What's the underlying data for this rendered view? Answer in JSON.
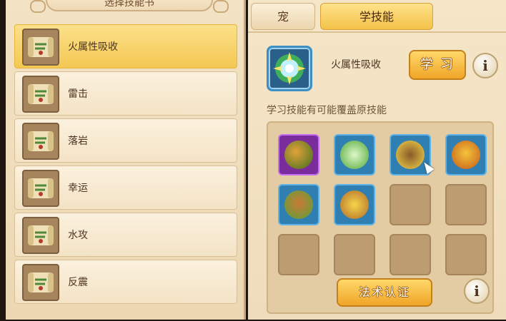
{
  "left_panel": {
    "title": "选择技能书",
    "skills": [
      {
        "name": "火属性吸收",
        "selected": true
      },
      {
        "name": "雷击",
        "selected": false
      },
      {
        "name": "落岩",
        "selected": false
      },
      {
        "name": "幸运",
        "selected": false
      },
      {
        "name": "水攻",
        "selected": false
      },
      {
        "name": "反震",
        "selected": false
      }
    ]
  },
  "tabs": [
    {
      "label": "宠",
      "active": false
    },
    {
      "label": "学技能",
      "active": true
    }
  ],
  "selected_skill": {
    "name": "火属性吸收",
    "icon": "fire-absorb-skill-icon"
  },
  "learn_button": "学习",
  "info_icon": "i",
  "hint_text": "学习技能有可能覆盖原技能",
  "pet_skills": [
    {
      "icon": "earth-skill-icon",
      "frame": "purple"
    },
    {
      "icon": "blade-skill-icon",
      "frame": "blue"
    },
    {
      "icon": "monster-skill-icon",
      "frame": "blue"
    },
    {
      "icon": "buddha-skill-icon",
      "frame": "blue"
    },
    {
      "icon": "warrior-skill-icon",
      "frame": "blue"
    },
    {
      "icon": "spinning-skill-icon",
      "frame": "blue"
    },
    {
      "icon": "empty",
      "frame": "empty"
    },
    {
      "icon": "empty",
      "frame": "empty"
    },
    {
      "icon": "empty",
      "frame": "empty"
    },
    {
      "icon": "empty",
      "frame": "empty"
    },
    {
      "icon": "empty",
      "frame": "empty"
    },
    {
      "icon": "empty",
      "frame": "empty"
    }
  ],
  "auth_button": "法术认证",
  "colors": {
    "selected_row": "#f4c853",
    "button_gold": "#f0a528",
    "slot_blue": "#2f7fb3",
    "slot_purple": "#7b2c9c",
    "slot_empty": "#bd9c72"
  }
}
